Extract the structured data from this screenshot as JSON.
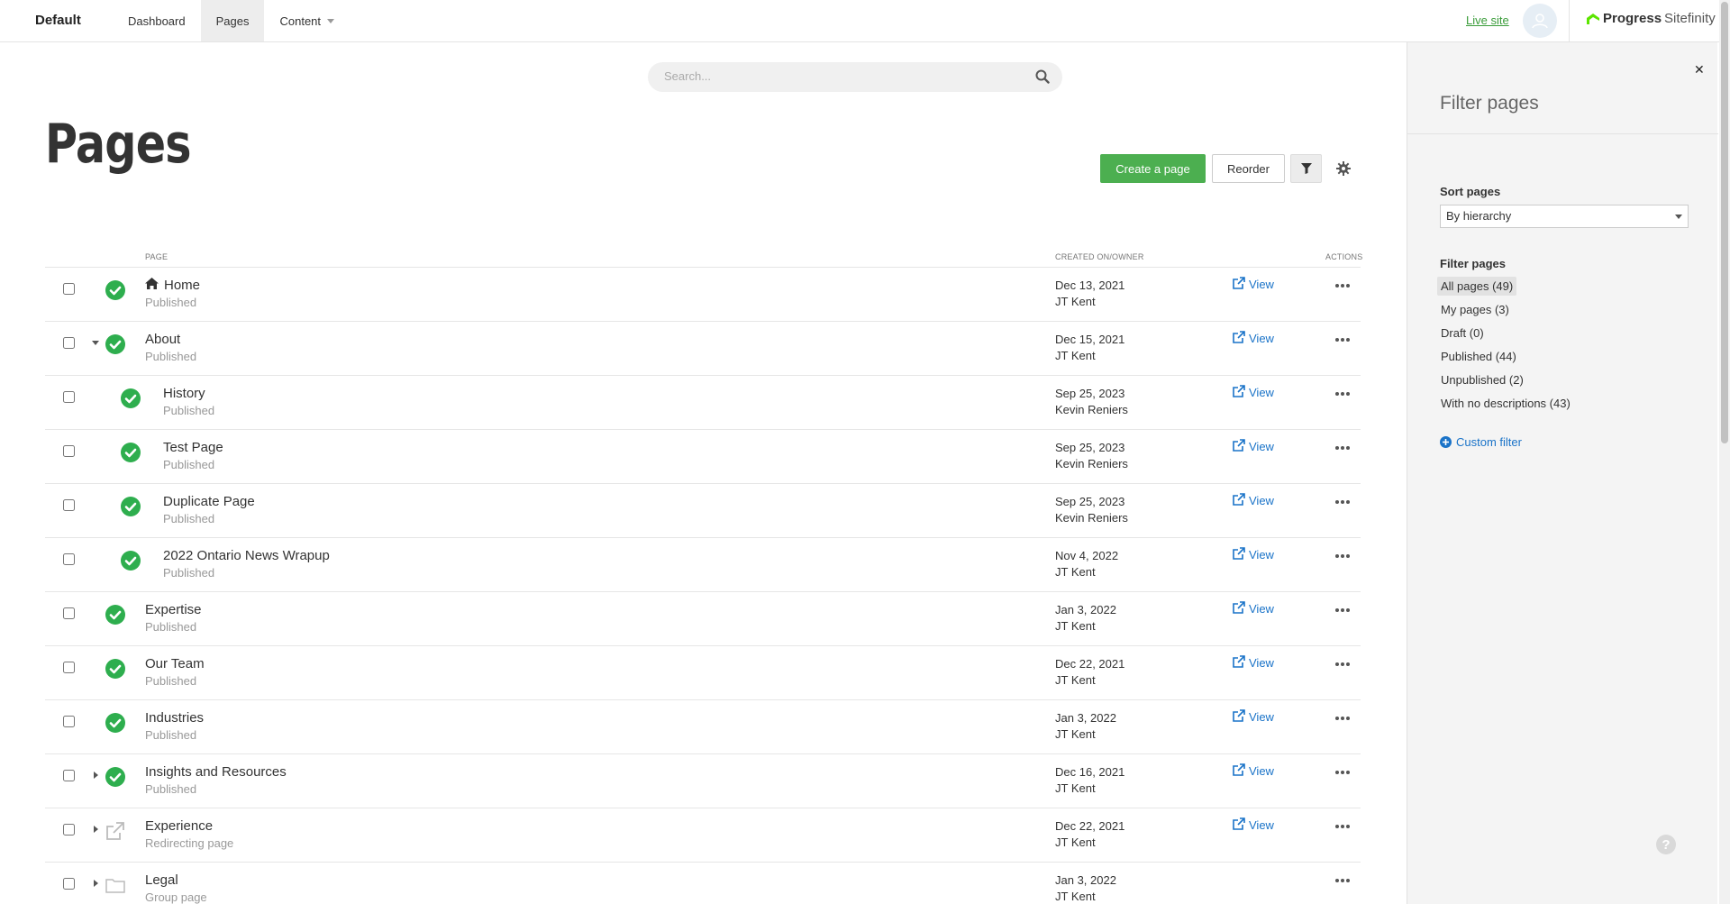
{
  "topbar": {
    "site_name": "Default",
    "nav": [
      {
        "label": "Dashboard"
      },
      {
        "label": "Pages"
      },
      {
        "label": "Content"
      }
    ],
    "live_site": "Live site",
    "logo_brand": "Progress",
    "logo_product": "Sitefinity"
  },
  "search": {
    "placeholder": "Search..."
  },
  "page": {
    "title": "Pages"
  },
  "toolbar": {
    "create_label": "Create a page",
    "reorder_label": "Reorder"
  },
  "table": {
    "headers": {
      "page": "PAGE",
      "created": "CREATED ON/OWNER",
      "actions": "ACTIONS"
    },
    "view_label": "View",
    "rows": [
      {
        "title": "Home",
        "status": "Published",
        "date": "Dec 13, 2021",
        "owner": "JT Kent",
        "icon": "check-circle-icon"
      },
      {
        "title": "About",
        "status": "Published",
        "date": "Dec 15, 2021",
        "owner": "JT Kent",
        "icon": "check-circle-icon"
      },
      {
        "title": "History",
        "status": "Published",
        "date": "Sep 25, 2023",
        "owner": "Kevin Reniers",
        "icon": "check-circle-icon"
      },
      {
        "title": "Test Page",
        "status": "Published",
        "date": "Sep 25, 2023",
        "owner": "Kevin Reniers",
        "icon": "check-circle-icon"
      },
      {
        "title": "Duplicate Page",
        "status": "Published",
        "date": "Sep 25, 2023",
        "owner": "Kevin Reniers",
        "icon": "check-circle-icon"
      },
      {
        "title": "2022 Ontario News Wrapup",
        "status": "Published",
        "date": "Nov 4, 2022",
        "owner": "JT Kent",
        "icon": "check-circle-icon"
      },
      {
        "title": "Expertise",
        "status": "Published",
        "date": "Jan 3, 2022",
        "owner": "JT Kent",
        "icon": "check-circle-icon"
      },
      {
        "title": "Our Team",
        "status": "Published",
        "date": "Dec 22, 2021",
        "owner": "JT Kent",
        "icon": "check-circle-icon"
      },
      {
        "title": "Industries",
        "status": "Published",
        "date": "Jan 3, 2022",
        "owner": "JT Kent",
        "icon": "check-circle-icon"
      },
      {
        "title": "Insights and Resources",
        "status": "Published",
        "date": "Dec 16, 2021",
        "owner": "JT Kent",
        "icon": "check-circle-icon"
      },
      {
        "title": "Experience",
        "status": "Redirecting page",
        "date": "Dec 22, 2021",
        "owner": "JT Kent",
        "icon": "external-link-icon"
      },
      {
        "title": "Legal",
        "status": "Group page",
        "date": "Jan 3, 2022",
        "owner": "JT Kent",
        "icon": "folder-icon"
      }
    ]
  },
  "filter_panel": {
    "title": "Filter pages",
    "sort_label": "Sort pages",
    "sort_value": "By hierarchy",
    "filter_label": "Filter pages",
    "filters": [
      {
        "label": "All pages (49)"
      },
      {
        "label": "My pages (3)"
      },
      {
        "label": "Draft (0)"
      },
      {
        "label": "Published (44)"
      },
      {
        "label": "Unpublished (2)"
      },
      {
        "label": "With no descriptions (43)"
      }
    ],
    "custom_filter": "Custom filter",
    "help": "?"
  },
  "colors": {
    "accent_green": "#4caf50",
    "link_blue": "#1a73c8",
    "status_green": "#2eae4e"
  }
}
